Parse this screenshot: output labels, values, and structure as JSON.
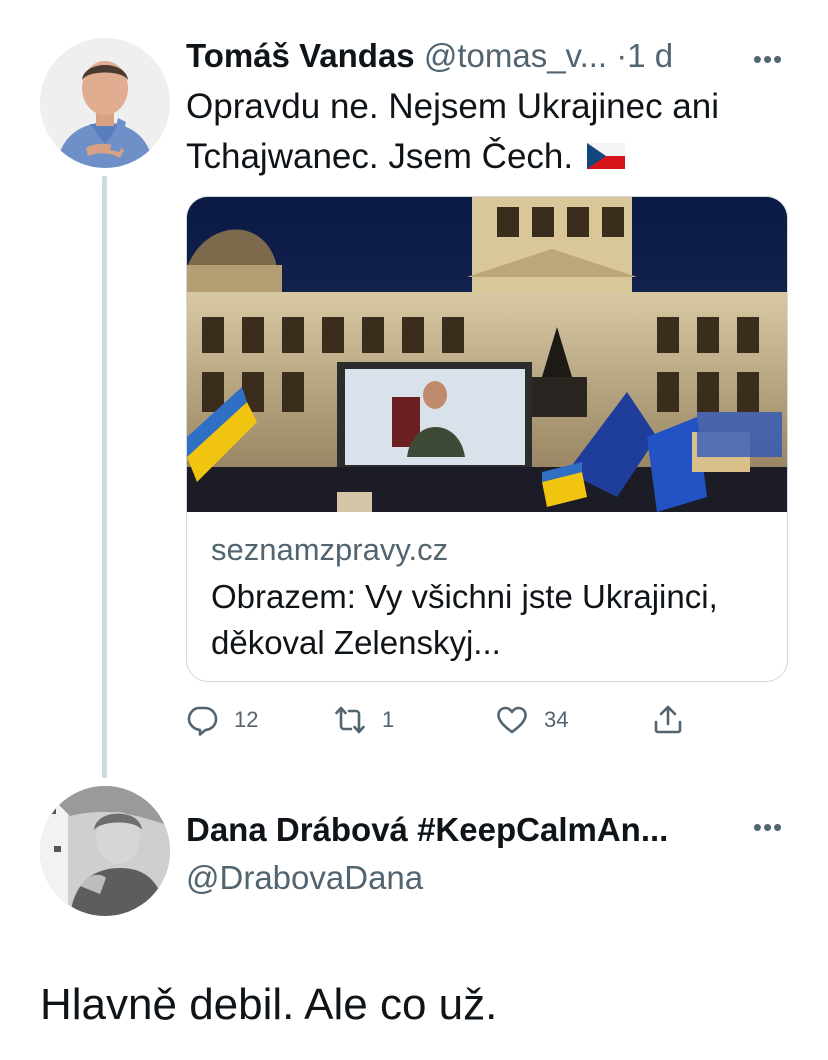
{
  "tweet": {
    "author_name": "Tomáš Vandas",
    "author_handle": "@tomas_v...",
    "separator": "·",
    "time": "1 d",
    "more_icon": "more-horizontal-icon",
    "text": "Opravdu ne. Nejsem Ukrajinec ani Tchajwanec. Jsem Čech.",
    "flag_icon": "czech-flag-icon",
    "card": {
      "domain": "seznamzpravy.cz",
      "title": "Obrazem: Vy všichni jste Ukrajinci, děkoval Zelenskyj..."
    },
    "actions": {
      "reply_count": "12",
      "retweet_count": "1",
      "like_count": "34",
      "reply_icon": "reply-icon",
      "retweet_icon": "retweet-icon",
      "like_icon": "heart-icon",
      "share_icon": "share-icon"
    }
  },
  "reply": {
    "author_name": "Dana Drábová #KeepCalmAn...",
    "author_handle": "@DrabovaDana",
    "more_icon": "more-horizontal-icon",
    "text": "Hlavně debil. Ale co už."
  },
  "colors": {
    "text_primary": "#0f1419",
    "text_secondary": "#536471",
    "border": "#cfd9de",
    "background": "#ffffff"
  }
}
